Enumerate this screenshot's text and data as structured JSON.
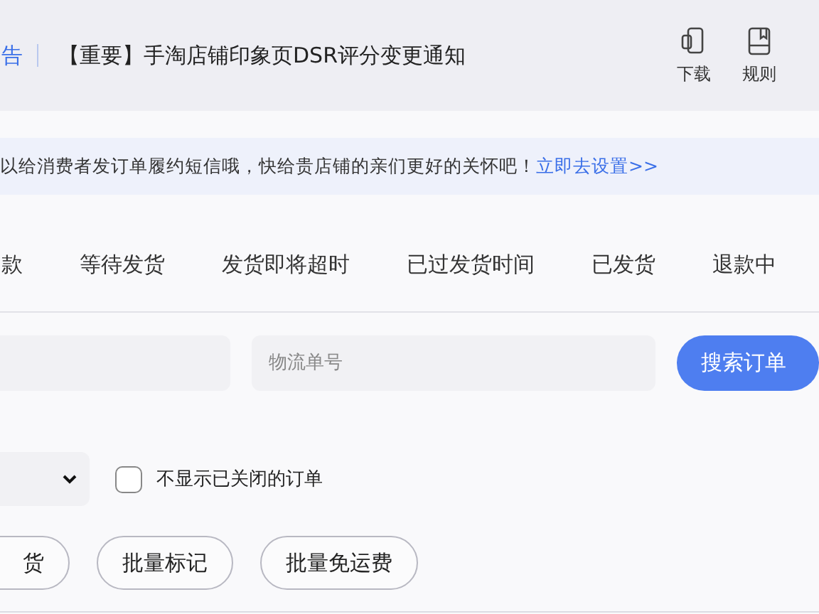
{
  "header": {
    "section_label": "告",
    "notice": "【重要】手淘店铺印象页DSR评分变更通知",
    "tools": [
      {
        "kind": "phone",
        "label": "下载"
      },
      {
        "kind": "book",
        "label": "规则"
      }
    ]
  },
  "banner": {
    "text": "以给消费者发订单履约短信哦，快给贵店铺的亲们更好的关怀吧！",
    "link": "立即去设置>>"
  },
  "tabs": [
    {
      "label": "款"
    },
    {
      "label": "等待发货"
    },
    {
      "label": "发货即将超时"
    },
    {
      "label": "已过发货时间"
    },
    {
      "label": "已发货"
    },
    {
      "label": "退款中"
    }
  ],
  "search": {
    "tracking_field": {
      "placeholder": "物流单号"
    },
    "button": "搜索订单"
  },
  "filters": {
    "hide_closed": {
      "label": "不显示已关闭的订单",
      "checked": false
    }
  },
  "actions": [
    "货",
    "批量标记",
    "批量免运费"
  ]
}
